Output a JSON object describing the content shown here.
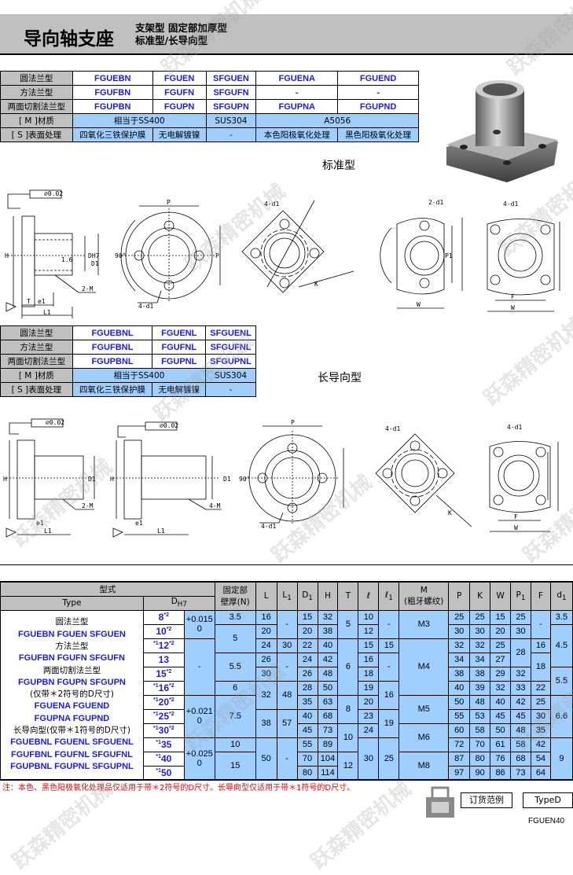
{
  "header": {
    "title": "导向轴支座",
    "subtitle_line1": "支架型 固定部加厚型",
    "subtitle_line2": "标准型/长导向型"
  },
  "standard_table": {
    "rows": [
      {
        "label": "圆法兰型",
        "cells": [
          "FGUEBN",
          "FGUEN",
          "SFGUEN",
          "FGUENA",
          "FGUEND"
        ]
      },
      {
        "label": "方法兰型",
        "cells": [
          "FGUFBN",
          "FGUFN",
          "SFGUFN",
          "-",
          "-"
        ]
      },
      {
        "label": "两面切割法兰型",
        "cells": [
          "FGUPBN",
          "FGUPN",
          "SFGUPN",
          "FGUPNA",
          "FGUPND"
        ]
      }
    ],
    "material": {
      "label": "[ M ]材质",
      "values": [
        "相当于SS400",
        "SUS304",
        "A5056"
      ]
    },
    "surface": {
      "label": "[ S ]表面处理",
      "values": [
        "四氧化三铁保护膜",
        "无电解镀镍",
        "-",
        "本色阳极氧化处理",
        "黑色阳极氧化处理"
      ]
    },
    "caption": "标准型"
  },
  "long_table": {
    "rows": [
      {
        "label": "圆法兰型",
        "cells": [
          "FGUEBNL",
          "FGUENL",
          "SFGUENL"
        ]
      },
      {
        "label": "方法兰型",
        "cells": [
          "FGUFBNL",
          "FGUFNL",
          "SFGUFNL"
        ]
      },
      {
        "label": "两面切割法兰型",
        "cells": [
          "FGUPBNL",
          "FGUPNL",
          "SFGUPNL"
        ]
      }
    ],
    "material": {
      "label": "[ M ]材质",
      "values": [
        "相当于SS400",
        "SUS304"
      ]
    },
    "surface": {
      "label": "[ S ]表面处理",
      "values": [
        "四氧化三铁保护膜",
        "无电解镀镍",
        "-"
      ]
    },
    "caption": "长导向型"
  },
  "drawing_labels": {
    "H": "H",
    "T": "T",
    "e1": "e1",
    "L1": "L1",
    "M2": "2-M",
    "M4": "4-M",
    "DH7": "DH7",
    "D1": "D1",
    "P": "P",
    "d1_4": "4-d1",
    "d1_2": "2-d1",
    "deg90": "90°",
    "K": "K",
    "W": "W",
    "F": "F",
    "P1": "P1",
    "tol": "⌀0.02",
    "rough": "1.6",
    "l": "ℓ"
  },
  "spec_table": {
    "header": {
      "model": "型式",
      "type": "Type",
      "D": "D",
      "D_sub": "H7",
      "N_line1": "固定部",
      "N_line2": "壁厚(N)",
      "L": "L",
      "L1": "L",
      "L1_sub": "1",
      "D1": "D",
      "D1_sub": "1",
      "H": "H",
      "T": "T",
      "l": "ℓ",
      "l1": "ℓ",
      "l1_sub": "1",
      "M_line1": "M",
      "M_line2": "(粗牙螺纹)",
      "P": "P",
      "K": "K",
      "W": "W",
      "P1": "P",
      "P1_sub": "1",
      "F": "F",
      "d1": "d",
      "d1_sub": "1"
    },
    "type_lines": [
      {
        "text": "圆法兰型",
        "models": false
      },
      {
        "text": "FGUEBN FGUEN SFGUEN",
        "models": true
      },
      {
        "text": "方法兰型",
        "models": false
      },
      {
        "text": "FGUFBN FGUFN SFGUFN",
        "models": true
      },
      {
        "text": "两面切割法兰型",
        "models": false
      },
      {
        "text": "FGUPBN FGUPN SFGUPN",
        "models": true
      },
      {
        "text": " ",
        "models": false
      },
      {
        "text": "(仅带＊2符号的D尺寸)",
        "models": false
      },
      {
        "text": "FGUENA FGUEND",
        "models": true
      },
      {
        "text": "FGUPNA FGUPND",
        "models": true
      },
      {
        "text": "长导向型(仅带＊1符号的D尺寸)",
        "models": false
      },
      {
        "text": "FGUEBNL FGUENL SFGUENL",
        "models": true
      },
      {
        "text": "FGUFBNL FGUFNL SFGUFNL",
        "models": true
      },
      {
        "text": "FGUPBNL FGUPNL SFGUPNL",
        "models": true
      }
    ],
    "D": [
      {
        "pre": "",
        "v": "8",
        "post": "*2"
      },
      {
        "pre": "",
        "v": "10",
        "post": "*2"
      },
      {
        "pre": "*1",
        "v": "12",
        "post": "*2"
      },
      {
        "pre": "",
        "v": "13",
        "post": ""
      },
      {
        "pre": "",
        "v": "15",
        "post": "*2"
      },
      {
        "pre": "*1",
        "v": "16",
        "post": "*2"
      },
      {
        "pre": "*1",
        "v": "20",
        "post": "*2"
      },
      {
        "pre": "*1",
        "v": "25",
        "post": "*2"
      },
      {
        "pre": "*1",
        "v": "30",
        "post": "*2"
      },
      {
        "pre": "*1",
        "v": "35",
        "post": ""
      },
      {
        "pre": "*1",
        "v": "40",
        "post": ""
      },
      {
        "pre": "*1",
        "v": "50",
        "post": ""
      }
    ],
    "tol": [
      [
        "+0.015",
        "0"
      ],
      [
        "-",
        ""
      ],
      [
        "+0.021",
        "0"
      ],
      [
        "+0.025",
        "0"
      ]
    ],
    "N": [
      "3.5",
      "5",
      "5.5",
      "6",
      "7.5",
      "10",
      "15"
    ],
    "L": [
      "16",
      "20",
      "24",
      "26",
      "30",
      "32",
      "38",
      "50"
    ],
    "L1": [
      "-",
      "30",
      "-",
      "48",
      "57",
      "-"
    ],
    "D1": [
      "15",
      "20",
      "22",
      "24",
      "26",
      "28",
      "35",
      "40",
      "45",
      "55",
      "70",
      "80"
    ],
    "H": [
      "32",
      "38",
      "40",
      "42",
      "48",
      "50",
      "63",
      "68",
      "73",
      "89",
      "104",
      "114"
    ],
    "T": [
      "5",
      "6",
      "8",
      "10",
      "12"
    ],
    "l": [
      "10",
      "12",
      "15",
      "16",
      "18",
      "19",
      "20",
      "23",
      "24",
      "30"
    ],
    "l1": [
      "-",
      "15",
      "-",
      "16",
      "19",
      "25"
    ],
    "M": [
      "M3",
      "M4",
      "M5",
      "M6",
      "M8"
    ],
    "P": [
      "25",
      "30",
      "32",
      "34",
      "38",
      "40",
      "50",
      "55",
      "60",
      "72",
      "87",
      "97"
    ],
    "K": [
      "25",
      "30",
      "32",
      "34",
      "38",
      "39",
      "48",
      "53",
      "58",
      "70",
      "80",
      "90"
    ],
    "W": [
      "15",
      "20",
      "25",
      "27",
      "29",
      "32",
      "40",
      "45",
      "50",
      "61",
      "76",
      "86"
    ],
    "P1": [
      "25",
      "30",
      "28",
      "32",
      "33",
      "42",
      "45",
      "48",
      "58",
      "68",
      "73"
    ],
    "F": [
      "-",
      "16",
      "18",
      "22",
      "25",
      "30",
      "35",
      "42",
      "54",
      "64"
    ],
    "d1": [
      "3.5",
      "4.5",
      "5.5",
      "6.6",
      "9"
    ]
  },
  "note": "注：本色、黑色阳极氧化处理品仅适用于带＊2符号的D尺寸。长导向型仅适用于带＊1符号的D尺寸。",
  "footer": {
    "order_example": "订货范例",
    "type": "TypeD",
    "code": "FGUEN40"
  },
  "watermark": "跃森精密机械",
  "colors": {
    "header_gray": "#c0c0c0",
    "cell_blue": "#9fcfff",
    "model_blue": "#1a1aff",
    "note_red": "#ff0000"
  }
}
